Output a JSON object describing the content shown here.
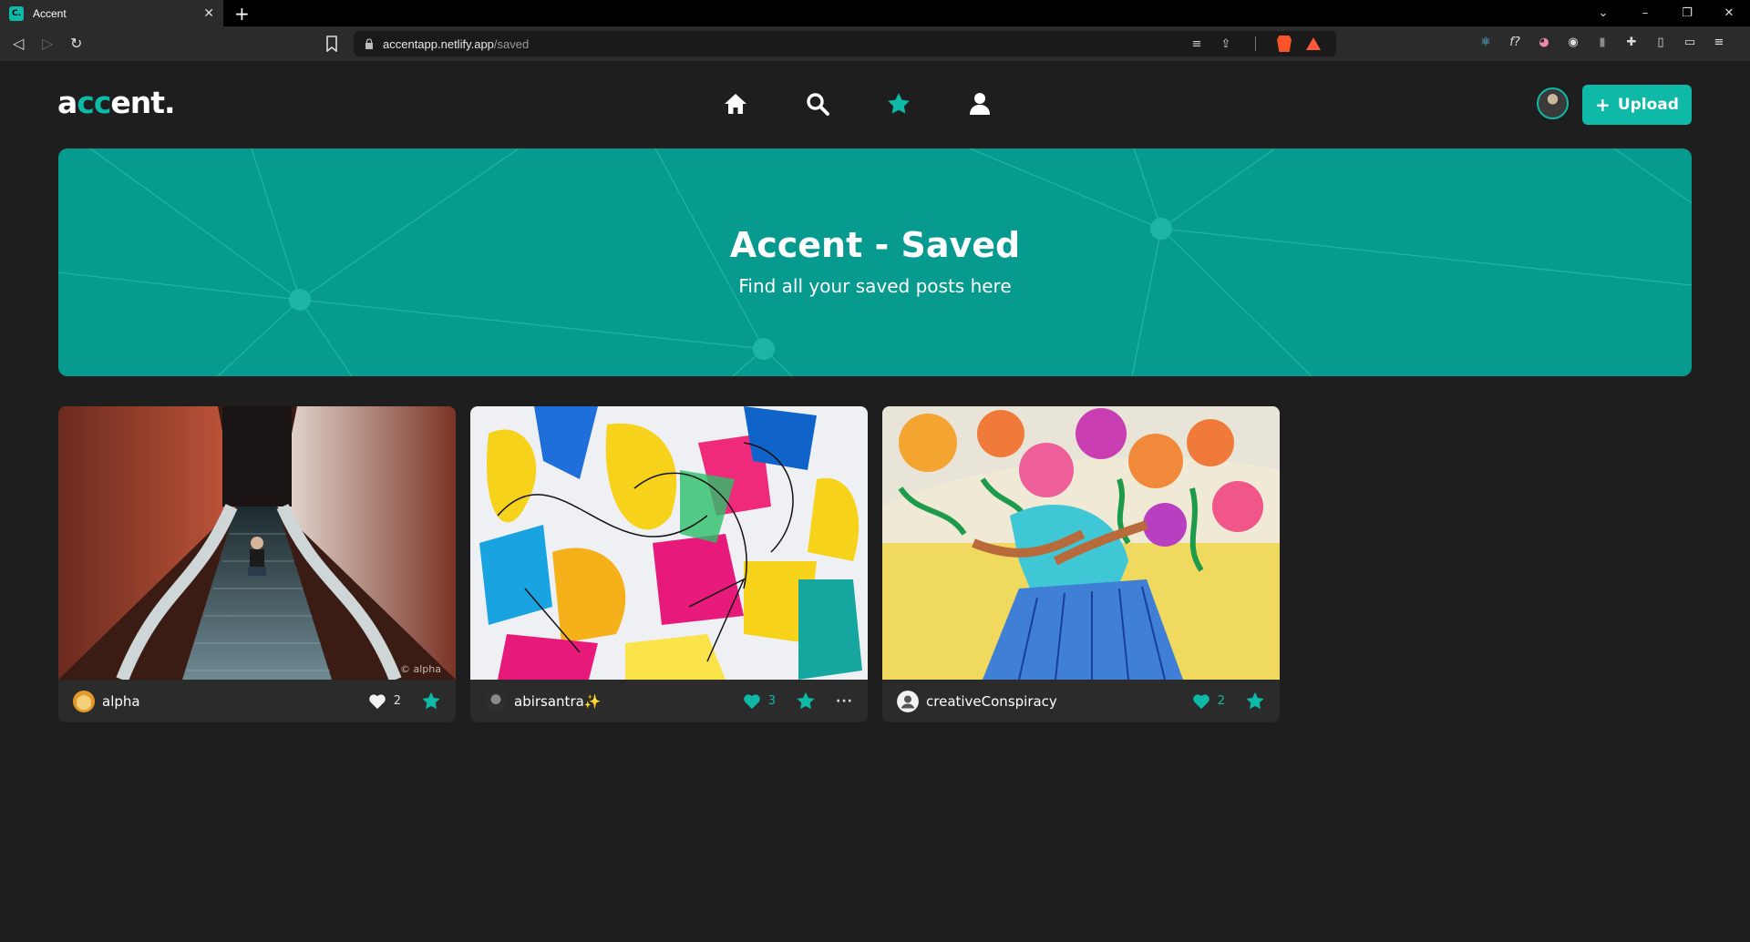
{
  "browser": {
    "tab_title": "Accent",
    "tab_favicon": "C.",
    "url_host": "accentapp.netlify.app",
    "url_path": "/saved"
  },
  "app": {
    "logo": {
      "pre": "a",
      "accent": "cc",
      "post": "ent."
    },
    "nav": [
      "home-icon",
      "search-icon",
      "star-icon",
      "user-icon"
    ],
    "upload_label": "Upload",
    "accent_color": "#0fb9a8"
  },
  "hero": {
    "title": "Accent - Saved",
    "subtitle": "Find all your saved posts here"
  },
  "posts": [
    {
      "user": "alpha",
      "likes": "2",
      "liked": false,
      "watermark": "© alpha"
    },
    {
      "user": "abirsantra✨",
      "likes": "3",
      "liked": true
    },
    {
      "user": "creativeConspiracy",
      "likes": "2",
      "liked": true
    }
  ]
}
